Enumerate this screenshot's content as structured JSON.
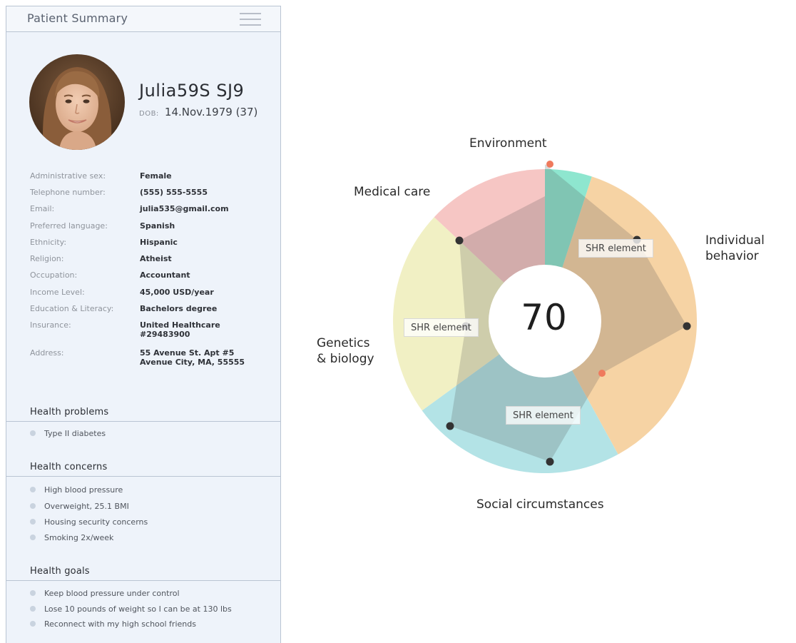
{
  "panel": {
    "title": "Patient Summary",
    "menu_icon": "hamburger-menu-icon"
  },
  "patient": {
    "name": "Julia59S SJ9",
    "dob_label": "DOB:",
    "dob_value": "14.Nov.1979 (37)",
    "avatar_icon": "patient-photo"
  },
  "details": [
    {
      "label": "Administrative sex:",
      "value": "Female"
    },
    {
      "label": "Telephone number:",
      "value": "(555) 555-5555"
    },
    {
      "label": "Email:",
      "value": "julia535@gmail.com"
    },
    {
      "label": "Preferred language:",
      "value": "Spanish"
    },
    {
      "label": "Ethnicity:",
      "value": "Hispanic"
    },
    {
      "label": "Religion:",
      "value": "Atheist"
    },
    {
      "label": "Occupation:",
      "value": "Accountant"
    },
    {
      "label": "Income Level:",
      "value": "45,000 USD/year"
    },
    {
      "label": "Education & Literacy:",
      "value": "Bachelors degree"
    },
    {
      "label": "Insurance:",
      "value": "United Healthcare\n#29483900"
    },
    {
      "label": "Address:",
      "value": "55 Avenue St. Apt #5\nAvenue City, MA, 55555"
    }
  ],
  "health_problems": {
    "title": "Health problems",
    "items": [
      "Type II diabetes"
    ]
  },
  "health_concerns": {
    "title": "Health concerns",
    "items": [
      "High blood pressure",
      "Overweight, 25.1 BMI",
      "Housing security concerns",
      "Smoking 2x/week"
    ]
  },
  "health_goals": {
    "title": "Health goals",
    "items": [
      "Keep blood pressure under control",
      "Lose 10 pounds of weight so I can be at 130 lbs",
      "Reconnect with my high school friends"
    ]
  },
  "chart": {
    "score": "70",
    "shr_label": "SHR element",
    "labels": {
      "environment": "Environment",
      "medical_care": "Medical care",
      "individual_behavior": "Individual\nbehavior",
      "genetics_biology": "Genetics\n& biology",
      "social_circumstances": "Social circumstances"
    }
  },
  "chart_data": {
    "type": "pie",
    "center_value": 70,
    "segments": [
      {
        "name": "Environment",
        "percent": 5,
        "color": "#8ee6cf"
      },
      {
        "name": "Individual behavior",
        "percent": 37,
        "color": "#f6d3a4"
      },
      {
        "name": "Social circumstances",
        "percent": 23,
        "color": "#b3e3e6"
      },
      {
        "name": "Genetics & biology",
        "percent": 22,
        "color": "#f1f0c4"
      },
      {
        "name": "Medical care",
        "percent": 13,
        "color": "#f6c6c4"
      }
    ],
    "marker_colors": {
      "dark": "#333333",
      "accent": "#ef7a5d"
    }
  }
}
